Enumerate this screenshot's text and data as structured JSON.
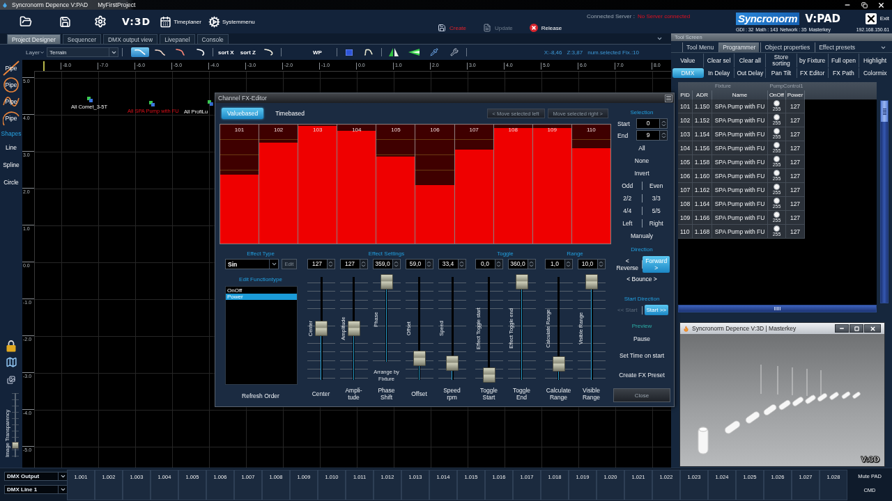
{
  "window": {
    "title": "Syncronorm Depence V:PAD",
    "project": "MyFirstProject"
  },
  "toolbar": {
    "logo": "V:3D",
    "menus": [
      {
        "label": "Timeplaner",
        "kind": "calendar"
      },
      {
        "label": "Systemmenu",
        "kind": "gears"
      }
    ],
    "actions": [
      {
        "label": "Create",
        "kind": "save",
        "alert": true,
        "disabled": false
      },
      {
        "label": "Update",
        "kind": "document",
        "alert": false,
        "disabled": true
      },
      {
        "label": "Release",
        "kind": "release",
        "alert": false,
        "disabled": false
      }
    ],
    "server": {
      "label": "Connected Server :",
      "value": "No Server connected",
      "connected": false
    },
    "brand": {
      "name": "Syncronorm",
      "product": "V:PAD"
    },
    "exit": "Exit",
    "stats": [
      "GDI : 32",
      "Math : 143",
      "Network : 35",
      "Masterkey"
    ],
    "ip": "192.168.150.61"
  },
  "tabs": [
    {
      "label": "Project Designer",
      "selected": true
    },
    {
      "label": "Sequencer",
      "selected": false
    },
    {
      "label": "DMX output view",
      "selected": false
    },
    {
      "label": "Livepanel",
      "selected": false
    },
    {
      "label": "Console",
      "selected": false
    }
  ],
  "designer_toolbar": {
    "layer_label": "Layer",
    "layer_value": "Terrain",
    "tool_groups": [
      [
        {
          "kind": "icon",
          "selected": true
        },
        {
          "kind": "icon",
          "selected": false
        },
        {
          "kind": "icon",
          "selected": false
        },
        {
          "kind": "icon",
          "selected": false
        }
      ],
      [
        {
          "kind": "text",
          "label": "sort X",
          "selected": false
        },
        {
          "kind": "text",
          "label": "sort Z",
          "selected": false
        },
        {
          "kind": "icon",
          "selected": false
        }
      ],
      [
        {
          "kind": "text",
          "label": "WP",
          "selected": false
        }
      ],
      [
        {
          "kind": "icon",
          "selected": false
        },
        {
          "kind": "icon",
          "selected": false
        }
      ],
      [
        {
          "kind": "icon",
          "selected": false
        },
        {
          "kind": "icon",
          "selected": false
        },
        {
          "kind": "icon",
          "selected": false
        },
        {
          "kind": "icon",
          "selected": false
        }
      ]
    ],
    "coords": [
      "X:-8,46",
      "Z:3,87"
    ],
    "selection_count": "num.selected Fix.:10"
  },
  "sidebar": {
    "pipe_tools": [
      {
        "label": "Pipe",
        "kind": "slash"
      },
      {
        "label": "Pipe",
        "kind": "ring"
      },
      {
        "label": "Pipe",
        "kind": "wave"
      },
      {
        "label": "Pipe",
        "kind": "arc"
      }
    ],
    "shapes_title": "Shapes",
    "shapes": [
      "Line",
      "Spline",
      "Circle"
    ],
    "transparency": {
      "label": "Image Transparency",
      "level": 0.15
    }
  },
  "canvas": {
    "x_ticks": [
      "-8.0",
      "-7.0",
      "-6.0",
      "-5.0",
      "-4.0",
      "-3.0",
      "-2.0",
      "-1.0",
      "0.0",
      "1.0",
      "2.0",
      "3.0",
      "4.0",
      "5.0",
      "6.0",
      "7.0",
      "8.0"
    ],
    "y_ticks": [
      "5.0",
      "4.0",
      "3.0",
      "2.0",
      "1.0",
      "0.0",
      "-1.0",
      "-2.0",
      "-3.0",
      "-4.0",
      "-5.0"
    ],
    "groups": [
      {
        "label": "All Comet_3-5T",
        "selected": false
      },
      {
        "label": "All SPA Pump with FU",
        "selected": true
      },
      {
        "label": "All ProfiLu",
        "selected": false
      }
    ]
  },
  "fx_editor": {
    "title": "Channel FX-Editor",
    "modes": [
      {
        "label": "Valuebased",
        "selected": true
      },
      {
        "label": "Timebased",
        "selected": false
      }
    ],
    "move_buttons": [
      "< Move selected left",
      "Move selected right >"
    ],
    "bars": [
      {
        "label": "101",
        "level": 0.58
      },
      {
        "label": "102",
        "level": 0.85
      },
      {
        "label": "103",
        "level": 0.99
      },
      {
        "label": "104",
        "level": 0.95
      },
      {
        "label": "105",
        "level": 0.73
      },
      {
        "label": "106",
        "level": 0.49
      },
      {
        "label": "107",
        "level": 0.79
      },
      {
        "label": "108",
        "level": 0.97
      },
      {
        "label": "109",
        "level": 0.97
      },
      {
        "label": "110",
        "level": 0.8
      }
    ],
    "effect_type": {
      "title": "Effect Type",
      "value": "Sin",
      "edit": "Edit"
    },
    "function_type": {
      "title": "Edit Functiontype",
      "items": [
        {
          "label": "OnOff",
          "selected": false
        },
        {
          "label": "Power",
          "selected": true
        }
      ]
    },
    "refresh": "Refresh Order",
    "fader_groups": [
      {
        "title": "Effect Settings",
        "faders": [
          {
            "value": "127",
            "label": "Center",
            "caption": "Center",
            "level": 0.5
          },
          {
            "value": "127",
            "label": "Amplitude",
            "caption": "Ampli-tude",
            "level": 0.5
          },
          {
            "value": "359,0",
            "label": "Phase",
            "caption": "Phase Shift",
            "level": 1.0,
            "note": "Arrange by Fixture"
          },
          {
            "value": "59,0",
            "label": "Offset",
            "caption": "Offset",
            "level": 0.18
          },
          {
            "value": "33,4",
            "label": "Speed",
            "caption": "Speed rpm",
            "level": 0.13
          }
        ]
      },
      {
        "title": "Toggle",
        "faders": [
          {
            "value": "0,0",
            "label": "Effect Toggle start",
            "caption": "Toggle Start",
            "level": 0.0
          },
          {
            "value": "360,0",
            "label": "Effect Toggle end",
            "caption": "Toggle End",
            "level": 1.0
          }
        ]
      },
      {
        "title": "Range",
        "faders": [
          {
            "value": "1,0",
            "label": "Calculate Range",
            "caption": "Calculate Range",
            "level": 0.12
          },
          {
            "value": "10,0",
            "label": "Visible Range",
            "caption": "Visible Range",
            "level": 1.0
          }
        ]
      }
    ],
    "selection": {
      "title": "Selection",
      "start_label": "Start",
      "start": "0",
      "end_label": "End",
      "end": "9",
      "rows": [
        [
          "All"
        ],
        [
          "None"
        ],
        [
          "Invert"
        ],
        [
          "Odd",
          "Even"
        ],
        [
          "2/2",
          "3/3"
        ],
        [
          "4/4",
          "5/5"
        ],
        [
          "Left",
          "Right"
        ],
        [
          "Manualy"
        ]
      ]
    },
    "direction": {
      "title": "Direction",
      "options": [
        {
          "label": "< Reverse",
          "selected": false
        },
        {
          "label": "Forward >",
          "selected": true
        },
        {
          "label": "< Bounce >",
          "selected": false
        }
      ]
    },
    "start_direction": {
      "title": "Start Direction",
      "options": [
        {
          "label": "<< Start",
          "selected": false
        },
        {
          "label": "Start >>",
          "selected": true
        }
      ]
    },
    "preview": {
      "title": "Preview",
      "actions": [
        "Pause",
        "Set Time on start",
        "Create FX Preset"
      ]
    },
    "close": "Close"
  },
  "tool_screen": {
    "title": "Tool Screen",
    "tabs": [
      {
        "label": "Tool Menu",
        "selected": false
      },
      {
        "label": "Programmer",
        "selected": true
      },
      {
        "label": "Object properties",
        "selected": false
      },
      {
        "label": "Effect presets",
        "selected": false
      }
    ],
    "buttons": [
      {
        "label": "Value",
        "selected": false
      },
      {
        "label": "Clear sel",
        "selected": false
      },
      {
        "label": "Clear all",
        "selected": false
      },
      {
        "label": "Store sorting",
        "selected": false
      },
      {
        "label": "by Fixture",
        "selected": false
      },
      {
        "label": "Full open",
        "selected": false
      },
      {
        "label": "Highlight",
        "selected": false
      },
      {
        "label": "DMX",
        "selected": true
      },
      {
        "label": "In Delay",
        "selected": false
      },
      {
        "label": "Out Delay",
        "selected": false
      },
      {
        "label": "Pan Tilt",
        "selected": false
      },
      {
        "label": "FX Editor",
        "selected": false
      },
      {
        "label": "FX Path",
        "selected": false
      },
      {
        "label": "Colormix",
        "selected": false
      }
    ],
    "table": {
      "groups": [
        {
          "label": "Fixture",
          "columns": [
            "PID",
            "ADR",
            "Name"
          ]
        },
        {
          "label": "PumpControl1",
          "columns": [
            "OnOff",
            "Power"
          ]
        }
      ],
      "rows": [
        {
          "pid": "101",
          "adr": "1.150",
          "name": "SPA Pump with FU",
          "onoff": {
            "on": true,
            "value": "255"
          },
          "power": "127"
        },
        {
          "pid": "102",
          "adr": "1.152",
          "name": "SPA Pump with FU",
          "onoff": {
            "on": true,
            "value": "255"
          },
          "power": "127"
        },
        {
          "pid": "103",
          "adr": "1.154",
          "name": "SPA Pump with FU",
          "onoff": {
            "on": true,
            "value": "255"
          },
          "power": "127"
        },
        {
          "pid": "104",
          "adr": "1.156",
          "name": "SPA Pump with FU",
          "onoff": {
            "on": true,
            "value": "255"
          },
          "power": "127"
        },
        {
          "pid": "105",
          "adr": "1.158",
          "name": "SPA Pump with FU",
          "onoff": {
            "on": true,
            "value": "255"
          },
          "power": "127"
        },
        {
          "pid": "106",
          "adr": "1.160",
          "name": "SPA Pump with FU",
          "onoff": {
            "on": true,
            "value": "255"
          },
          "power": "127"
        },
        {
          "pid": "107",
          "adr": "1.162",
          "name": "SPA Pump with FU",
          "onoff": {
            "on": true,
            "value": "255"
          },
          "power": "127"
        },
        {
          "pid": "108",
          "adr": "1.164",
          "name": "SPA Pump with FU",
          "onoff": {
            "on": true,
            "value": "255"
          },
          "power": "127"
        },
        {
          "pid": "109",
          "adr": "1.166",
          "name": "SPA Pump with FU",
          "onoff": {
            "on": true,
            "value": "255"
          },
          "power": "127"
        },
        {
          "pid": "110",
          "adr": "1.168",
          "name": "SPA Pump with FU",
          "onoff": {
            "on": true,
            "value": "255"
          },
          "power": "127"
        }
      ]
    }
  },
  "viewer": {
    "title": "Syncronorm Depence V:3D | Masterkey",
    "logo": "V:3D"
  },
  "bottom_bar": {
    "output": "DMX Output",
    "line": "DMX Line 1",
    "channels": [
      "1.001",
      "1.002",
      "1.003",
      "1.004",
      "1.005",
      "1.006",
      "1.007",
      "1.008",
      "1.009",
      "1.010",
      "1.011",
      "1.012",
      "1.013",
      "1.014",
      "1.015",
      "1.016",
      "1.017",
      "1.018",
      "1.019",
      "1.020",
      "1.021",
      "1.022",
      "1.023",
      "1.024",
      "1.025",
      "1.026",
      "1.027",
      "1.028"
    ],
    "mute": "Mute PAD",
    "cmd": "CMD"
  }
}
